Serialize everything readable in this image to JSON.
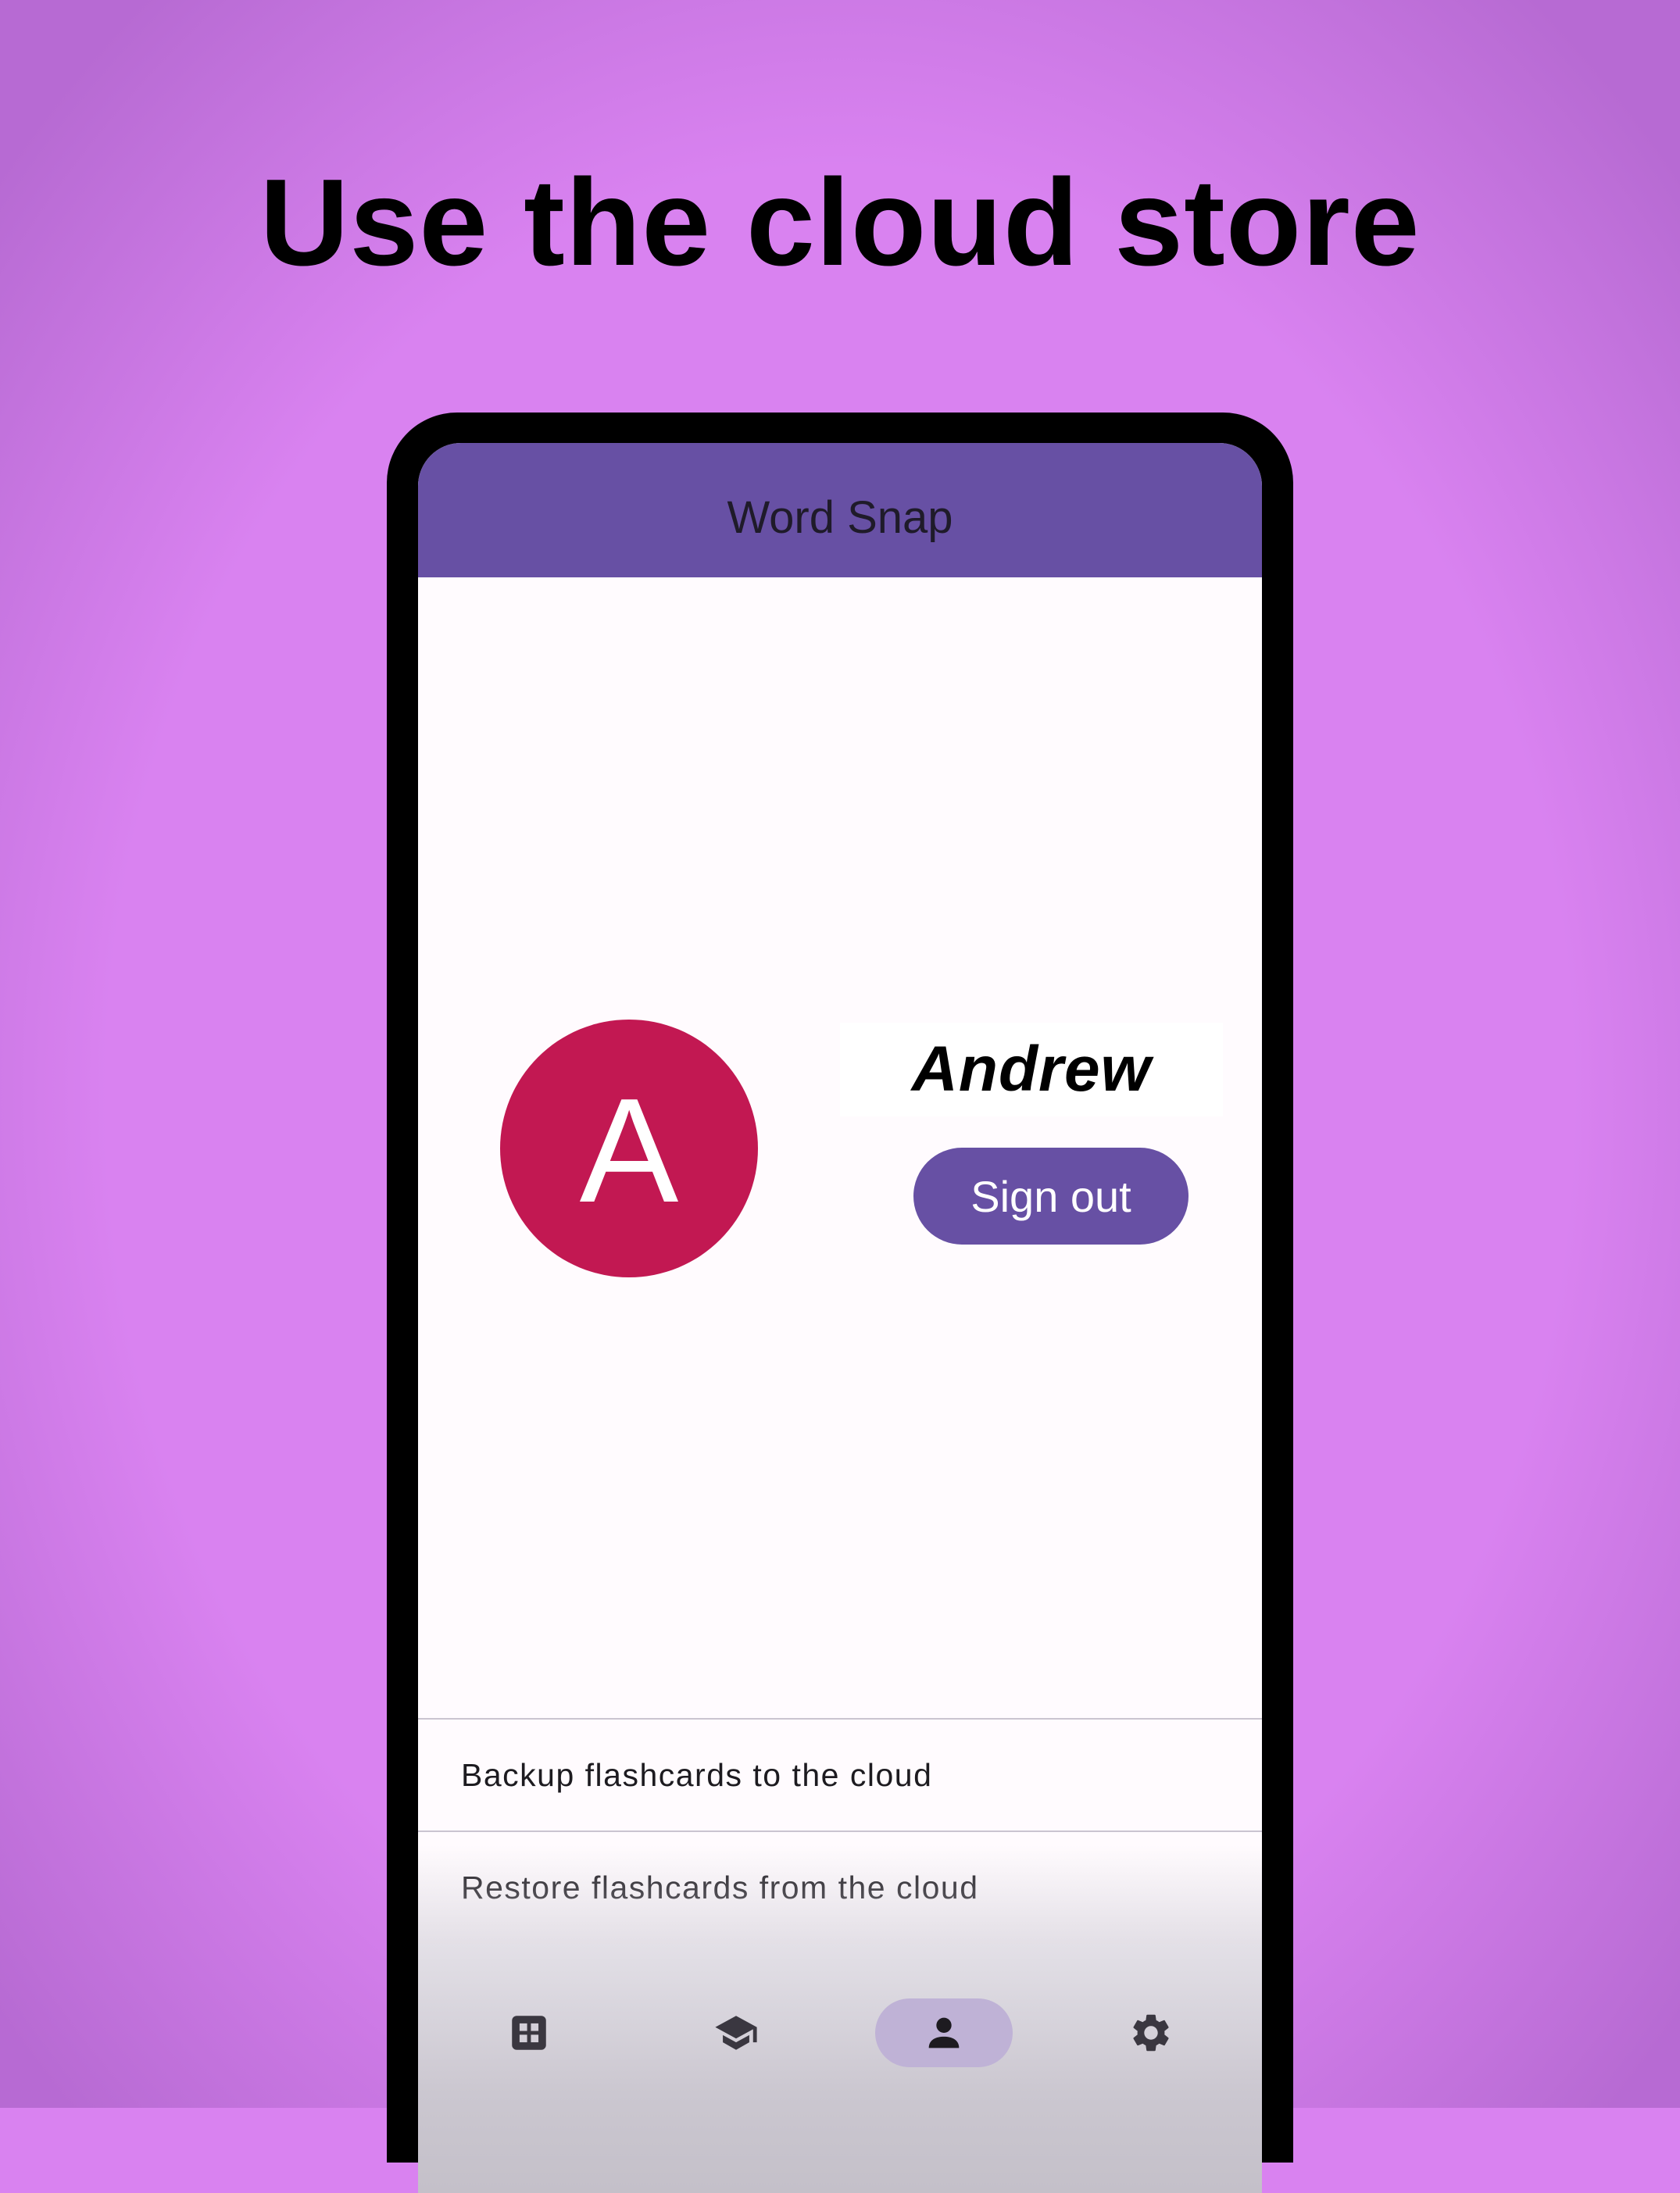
{
  "headline": "Use the cloud store",
  "app": {
    "title": "Word Snap"
  },
  "profile": {
    "avatar_letter": "A",
    "avatar_color": "#c21852",
    "name": "Andrew",
    "sign_out_label": "Sign out"
  },
  "actions": [
    {
      "label": "Backup flashcards to the cloud"
    },
    {
      "label": "Restore flashcards from the cloud"
    }
  ],
  "nav": {
    "items": [
      {
        "icon": "dashboard-grid-icon",
        "active": false
      },
      {
        "icon": "graduation-cap-icon",
        "active": false
      },
      {
        "icon": "person-icon",
        "active": true
      },
      {
        "icon": "gear-icon",
        "active": false
      }
    ]
  },
  "colors": {
    "background": "#d982f0",
    "primary": "#6750a4",
    "active_indicator": "#bfb2d6"
  }
}
